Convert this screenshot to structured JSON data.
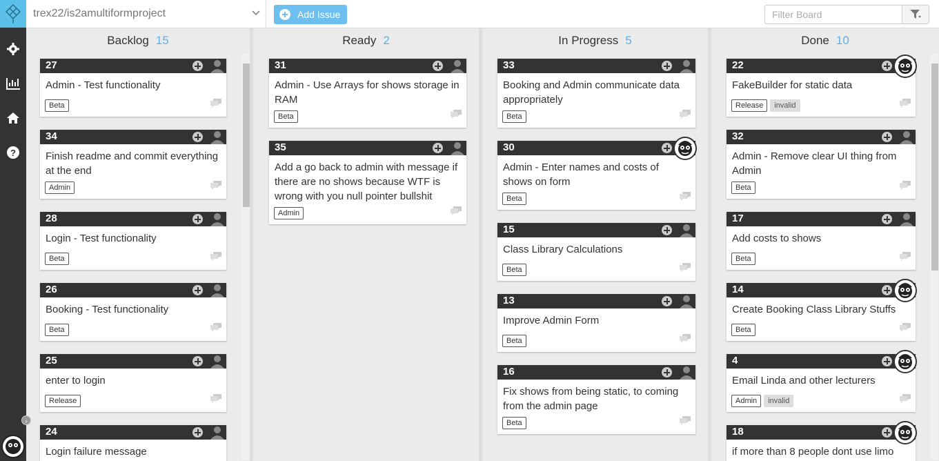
{
  "topbar": {
    "repo_name": "trex22/is2amultiformproject",
    "add_issue_label": "Add Issue",
    "filter_placeholder": "Filter Board"
  },
  "sidebar": {
    "items": [
      "gear-icon",
      "chart-icon",
      "home-icon",
      "help-icon"
    ]
  },
  "columns": [
    {
      "name": "Backlog",
      "count": "15",
      "cards": [
        {
          "number": "27",
          "title": "Admin - Test functionality",
          "labels": [
            "Beta"
          ]
        },
        {
          "number": "34",
          "title": "Finish readme and commit everything at the end",
          "labels": [
            "Admin"
          ]
        },
        {
          "number": "28",
          "title": "Login - Test functionality",
          "labels": [
            "Beta"
          ]
        },
        {
          "number": "26",
          "title": "Booking - Test functionality",
          "labels": [
            "Beta"
          ]
        },
        {
          "number": "25",
          "title": "enter to login",
          "labels": [
            "Release"
          ]
        },
        {
          "number": "24",
          "title": "Login failure message",
          "labels": []
        }
      ]
    },
    {
      "name": "Ready",
      "count": "2",
      "cards": [
        {
          "number": "31",
          "title": "Admin - Use Arrays for shows storage in RAM",
          "labels": [
            "Beta"
          ]
        },
        {
          "number": "35",
          "title": "Add a go back to admin with message if there are no shows because WTF is wrong with you null pointer bullshit",
          "labels": [
            "Admin"
          ]
        }
      ]
    },
    {
      "name": "In Progress",
      "count": "5",
      "cards": [
        {
          "number": "33",
          "title": "Booking and Admin communicate data appropriately",
          "labels": [
            "Beta"
          ]
        },
        {
          "number": "30",
          "title": "Admin - Enter names and costs of shows on form",
          "labels": [
            "Beta"
          ]
        },
        {
          "number": "15",
          "title": "Class Library Calculations",
          "labels": [
            "Beta"
          ]
        },
        {
          "number": "13",
          "title": "Improve Admin Form",
          "labels": [
            "Beta"
          ]
        },
        {
          "number": "16",
          "title": "Fix shows from being static, to coming from the admin page",
          "labels": [
            "Beta"
          ]
        }
      ]
    },
    {
      "name": "Done",
      "count": "10",
      "cards": [
        {
          "number": "22",
          "title": "FakeBuilder for static data",
          "labels": [
            "Release",
            "invalid"
          ]
        },
        {
          "number": "32",
          "title": "Admin - Remove clear UI thing from Admin",
          "labels": [
            "Beta"
          ]
        },
        {
          "number": "17",
          "title": "Add costs to shows",
          "labels": [
            "Beta"
          ]
        },
        {
          "number": "14",
          "title": "Create Booking Class Library Stuffs",
          "labels": [
            "Beta"
          ]
        },
        {
          "number": "4",
          "title": "Email Linda and other lecturers",
          "labels": [
            "Admin",
            "invalid"
          ]
        },
        {
          "number": "18",
          "title": "if more than 8 people dont use limo",
          "labels": []
        }
      ]
    }
  ],
  "colors": {
    "accent": "#5bc0ea",
    "count": "#5bb0e8",
    "card_header": "#333333"
  }
}
